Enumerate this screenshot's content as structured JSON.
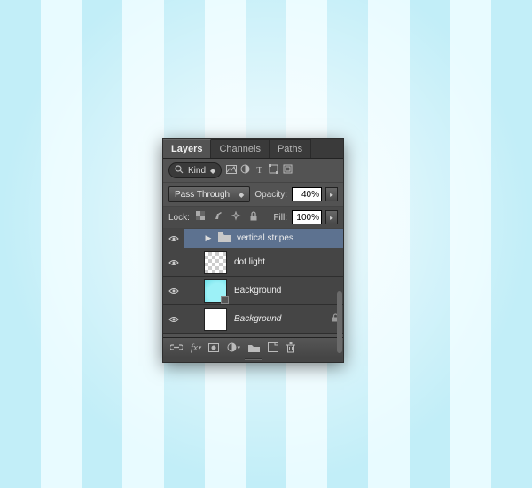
{
  "tabs": {
    "layers": "Layers",
    "channels": "Channels",
    "paths": "Paths"
  },
  "filter": {
    "label": "Kind"
  },
  "blend": {
    "mode": "Pass Through",
    "opacity_label": "Opacity:",
    "opacity_value": "40%"
  },
  "lock": {
    "label": "Lock:",
    "fill_label": "Fill:",
    "fill_value": "100%"
  },
  "layers": {
    "group": {
      "name": "vertical stripes"
    },
    "dotlight": {
      "name": "dot light"
    },
    "bgcyan": {
      "name": "Background"
    },
    "bgwhite": {
      "name": "Background"
    }
  }
}
